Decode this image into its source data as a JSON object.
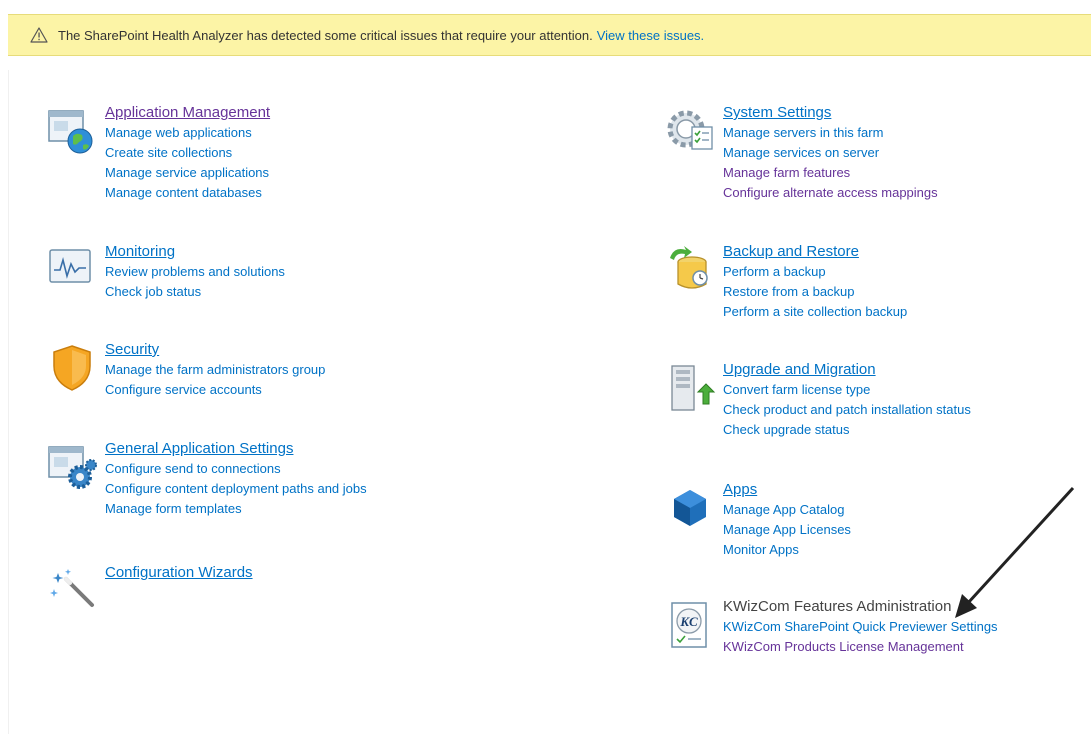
{
  "alert": {
    "message": "The SharePoint Health Analyzer has detected some critical issues that require your attention.",
    "link_label": "View these issues."
  },
  "sections": {
    "application_management": {
      "title": "Application Management",
      "links": [
        "Manage web applications",
        "Create site collections",
        "Manage service applications",
        "Manage content databases"
      ]
    },
    "monitoring": {
      "title": "Monitoring",
      "links": [
        "Review problems and solutions",
        "Check job status"
      ]
    },
    "security": {
      "title": "Security",
      "links": [
        "Manage the farm administrators group",
        "Configure service accounts"
      ]
    },
    "general_application_settings": {
      "title": "General Application Settings",
      "links": [
        "Configure send to connections",
        "Configure content deployment paths and jobs",
        "Manage form templates"
      ]
    },
    "configuration_wizards": {
      "title": "Configuration Wizards",
      "links": []
    },
    "system_settings": {
      "title": "System Settings",
      "links": [
        "Manage servers in this farm",
        "Manage services on server",
        "Manage farm features",
        "Configure alternate access mappings"
      ]
    },
    "backup_and_restore": {
      "title": "Backup and Restore",
      "links": [
        "Perform a backup",
        "Restore from a backup",
        "Perform a site collection backup"
      ]
    },
    "upgrade_and_migration": {
      "title": "Upgrade and Migration",
      "links": [
        "Convert farm license type",
        "Check product and patch installation status",
        "Check upgrade status"
      ]
    },
    "apps": {
      "title": "Apps",
      "links": [
        "Manage App Catalog",
        "Manage App Licenses",
        "Monitor Apps"
      ]
    },
    "kwizcom": {
      "title": "KWizCom Features Administration",
      "links": [
        "KWizCom SharePoint Quick Previewer Settings",
        "KWizCom Products License Management"
      ]
    }
  },
  "icons": {
    "alert": "warning-triangle-icon",
    "application_management": "application-globe-icon",
    "monitoring": "monitoring-chart-icon",
    "security": "security-shield-icon",
    "general_application_settings": "general-settings-gear-icon",
    "configuration_wizards": "magic-wand-icon",
    "system_settings": "system-settings-gear-icon",
    "backup_and_restore": "backup-database-icon",
    "upgrade_and_migration": "upgrade-server-icon",
    "apps": "apps-cube-icon",
    "kwizcom": "kwizcom-logo-icon"
  },
  "colors": {
    "link": "#0072c6",
    "visited_link": "#663399",
    "alert_background": "#fcf4a6",
    "heading_dark": "#444444"
  }
}
